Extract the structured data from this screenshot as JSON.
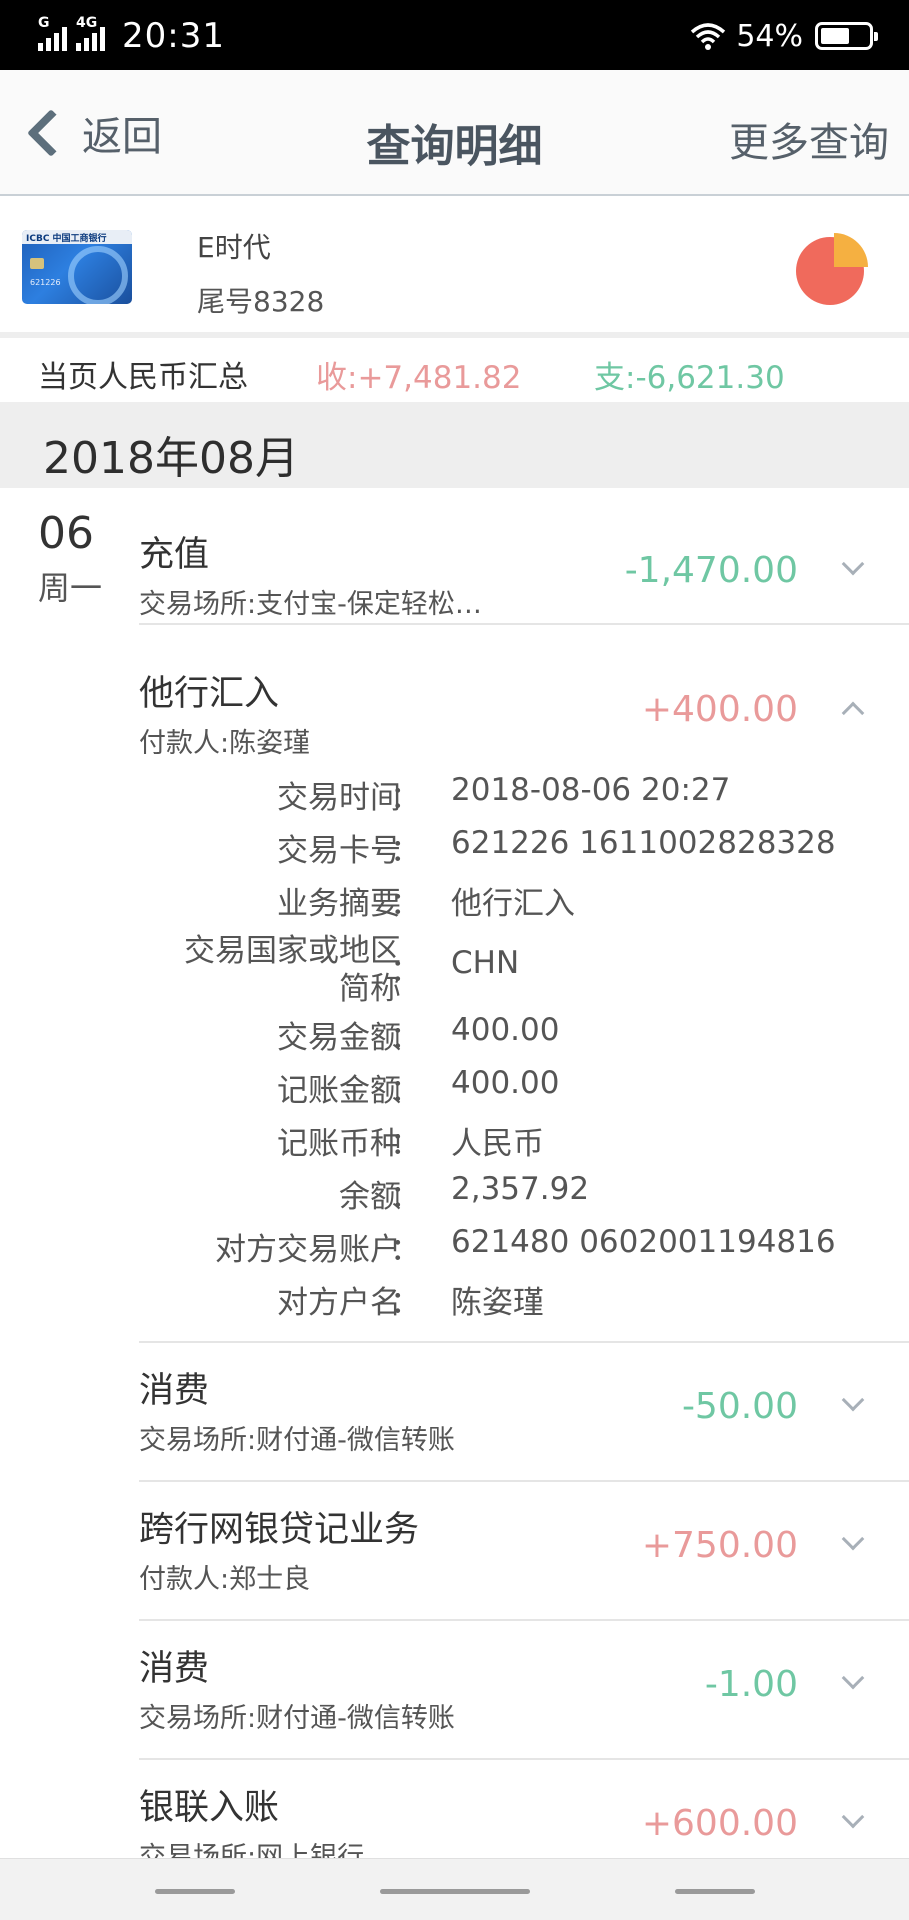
{
  "status_bar": {
    "time": "20:31",
    "network": "4G",
    "sim_label": "G",
    "battery": "54%"
  },
  "nav": {
    "back_label": "返回",
    "title": "查询明细",
    "more_label": "更多查询"
  },
  "card": {
    "name": "E时代",
    "tail": "尾号8328",
    "card_logo_text": "ICBC 中国工商银行",
    "card_number_text": "621226"
  },
  "summary": {
    "label": "当页人民币汇总",
    "income": "收:+7,481.82",
    "expense": "支:-6,621.30"
  },
  "month": "2018年08月",
  "day": {
    "date": "06",
    "weekday": "周一"
  },
  "transactions": [
    {
      "title": "充值",
      "subtitle": "交易场所:支付宝-保定轻松…",
      "amount": "-1,470.00"
    },
    {
      "title": "他行汇入",
      "subtitle": "付款人:陈姿瑾",
      "amount": "+400.00"
    },
    {
      "title": "消费",
      "subtitle": "交易场所:财付通-微信转账",
      "amount": "-50.00"
    },
    {
      "title": "跨行网银贷记业务",
      "subtitle": "付款人:郑士良",
      "amount": "+750.00"
    },
    {
      "title": "消费",
      "subtitle": "交易场所:财付通-微信转账",
      "amount": "-1.00"
    },
    {
      "title": "银联入账",
      "subtitle": "交易场所:网上银行",
      "amount": "+600.00"
    }
  ],
  "detail": [
    {
      "key": "交易时间",
      "value": "2018-08-06 20:27"
    },
    {
      "key": "交易卡号",
      "value": "621226 1611002828328"
    },
    {
      "key": "业务摘要",
      "value": "他行汇入"
    },
    {
      "key": "交易国家或地区",
      "key2": "简称",
      "value": "CHN"
    },
    {
      "key": "交易金额",
      "value": "400.00"
    },
    {
      "key": "记账金额",
      "value": "400.00"
    },
    {
      "key": "记账币种",
      "value": "人民币"
    },
    {
      "key": "余额",
      "value": "2,357.92"
    },
    {
      "key": "对方交易账户",
      "value": "621480 0602001194816"
    },
    {
      "key": "对方户名",
      "value": "陈姿瑾"
    }
  ],
  "detail_colon": "：",
  "colors": {
    "income": "#e99a9a",
    "expense": "#6fc7a3",
    "pie_main": "#f06a5c",
    "pie_slice": "#f5b041"
  }
}
